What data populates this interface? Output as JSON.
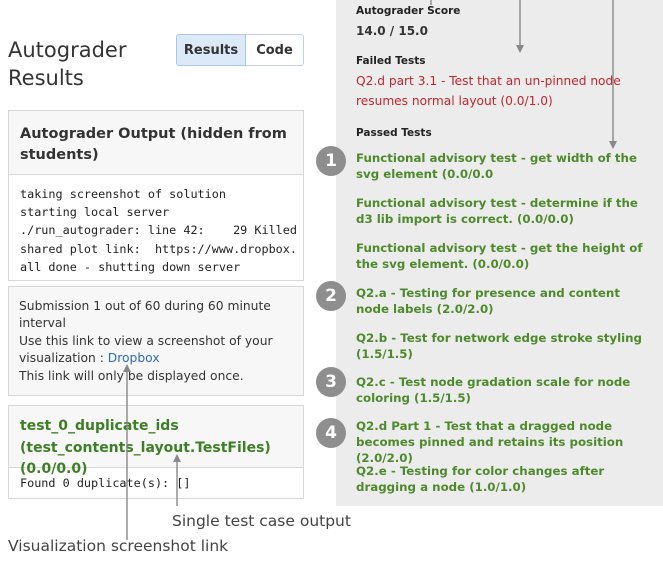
{
  "header": {
    "title": "Autograder Results",
    "tabs": [
      {
        "label": "Results"
      },
      {
        "label": "Code"
      }
    ]
  },
  "output": {
    "heading": "Autograder Output (hidden from students)",
    "lines": [
      "taking screenshot of solution",
      "starting local server",
      "./run_autograder: line 42:    29 Killed",
      "shared plot link:  https://www.dropbox.",
      "all done - shutting down server"
    ]
  },
  "submission": {
    "line1": "Submission 1 out of 60 during 60 minute",
    "line2": "interval",
    "line3": "Use this link to view a screenshot of your",
    "line4_prefix": "visualization : ",
    "link_text": "Dropbox",
    "line5": "This link will only be displayed once."
  },
  "test_case": {
    "heading": "test_0_duplicate_ids (test_contents_layout.TestFiles) (0.0/0.0)",
    "output": "Found 0 duplicate(s): []"
  },
  "captions": {
    "single_test": "Single test case output",
    "screenshot_link": "Visualization screenshot link"
  },
  "score_panel": {
    "score_label": "Autograder Score",
    "score": "14.0 / 15.0",
    "failed_label": "Failed Tests",
    "failed": [
      "Q2.d part 3.1 - Test that an un-pinned node resumes normal layout (0.0/1.0)"
    ],
    "passed_label": "Passed Tests",
    "passed": [
      "Functional advisory test - get width of the svg element (0.0/0.0",
      "Functional advisory test - determine if the d3 lib import is correct. (0.0/0.0)",
      "Functional advisory test - get the height of the svg element. (0.0/0.0)",
      "Q2.a - Testing for presence and content node labels (2.0/2.0)",
      "Q2.b - Test for network edge stroke styling (1.5/1.5)",
      "Q2.c - Test node gradation scale for node coloring (1.5/1.5)",
      "Q2.d Part 1 - Test that a dragged node becomes pinned and retains its position (2.0/2.0)",
      "Q2.e - Testing for color changes after dragging a node (1.0/1.0)"
    ],
    "badges": [
      "1",
      "2",
      "3",
      "4"
    ]
  },
  "colors": {
    "failed": "#c0282e",
    "passed": "#4e8a2b",
    "link": "#2f6db5",
    "badge": "#8e8e8e",
    "active_tab": "#dbe9f9"
  }
}
